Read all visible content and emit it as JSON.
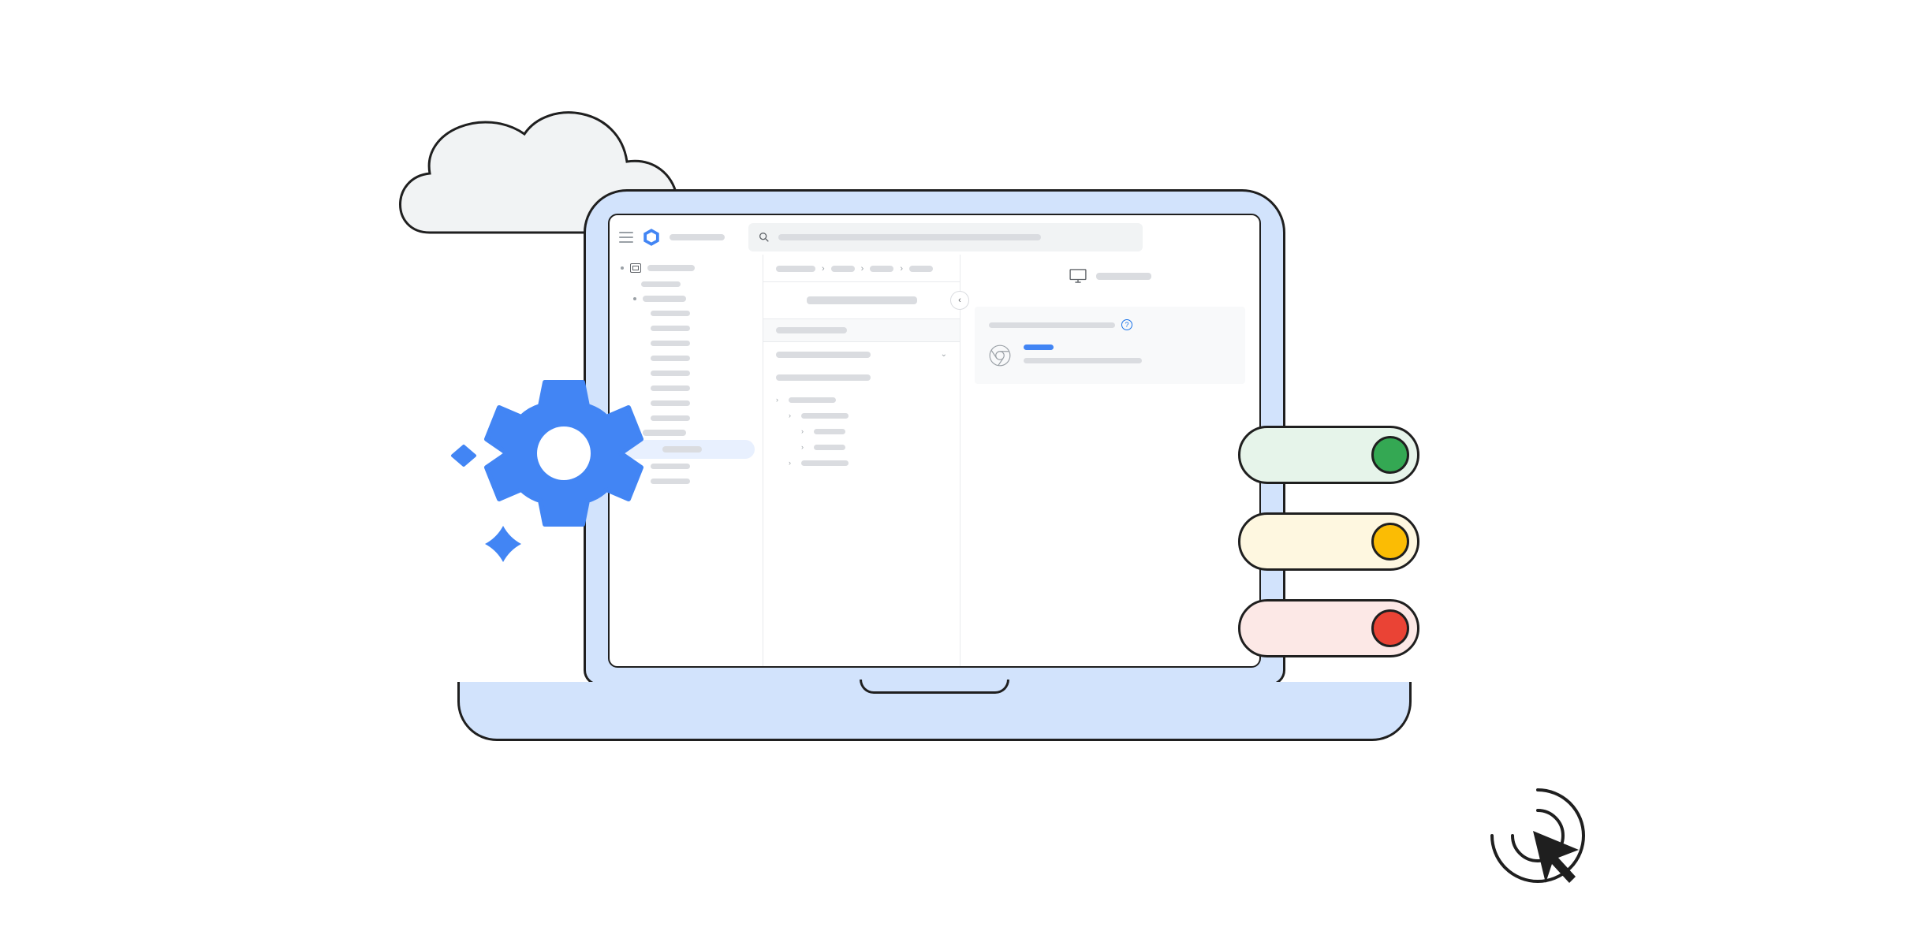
{
  "illustration": {
    "description": "Stylized illustration of a laptop displaying a generic admin console / settings dashboard, with a cloud, gear, status pills and cursor target.",
    "cloud": {
      "color": "#f1f3f4",
      "outline": "#1f1f1f"
    },
    "gear": {
      "color": "#4285f4",
      "hole": "#ffffff"
    },
    "sparkles": {
      "color": "#4285f4",
      "count": 2
    },
    "laptop": {
      "bezel": "#d2e3fc",
      "outline": "#1f1f1f",
      "screen_bg": "#ffffff"
    },
    "status_pills": [
      {
        "bg": "#e6f4ea",
        "dot": "#34a853",
        "label": "status-ok"
      },
      {
        "bg": "#fef7e0",
        "dot": "#fbbc04",
        "label": "status-warning"
      },
      {
        "bg": "#fce8e6",
        "dot": "#ea4335",
        "label": "status-error"
      }
    ],
    "cursor": {
      "rings": 2,
      "outline": "#1f1f1f"
    }
  },
  "console": {
    "topbar": {
      "menu_icon": "menu",
      "logo_icon": "hexagon-logo",
      "title_placeholder": "",
      "search_placeholder": ""
    },
    "sidebar": {
      "header_icon": "devices-icon",
      "items_count": 12,
      "selected_index": 9
    },
    "breadcrumb_segments": 4,
    "center_panel": {
      "has_title": true,
      "section_header": true,
      "dropdown_rows": 2,
      "tree_nodes": 5
    },
    "right_panel": {
      "header_icon": "monitor-icon",
      "card": {
        "help_icon": true,
        "chrome_icon": true,
        "link_bar": "blue",
        "text_bar": "gray"
      }
    }
  }
}
